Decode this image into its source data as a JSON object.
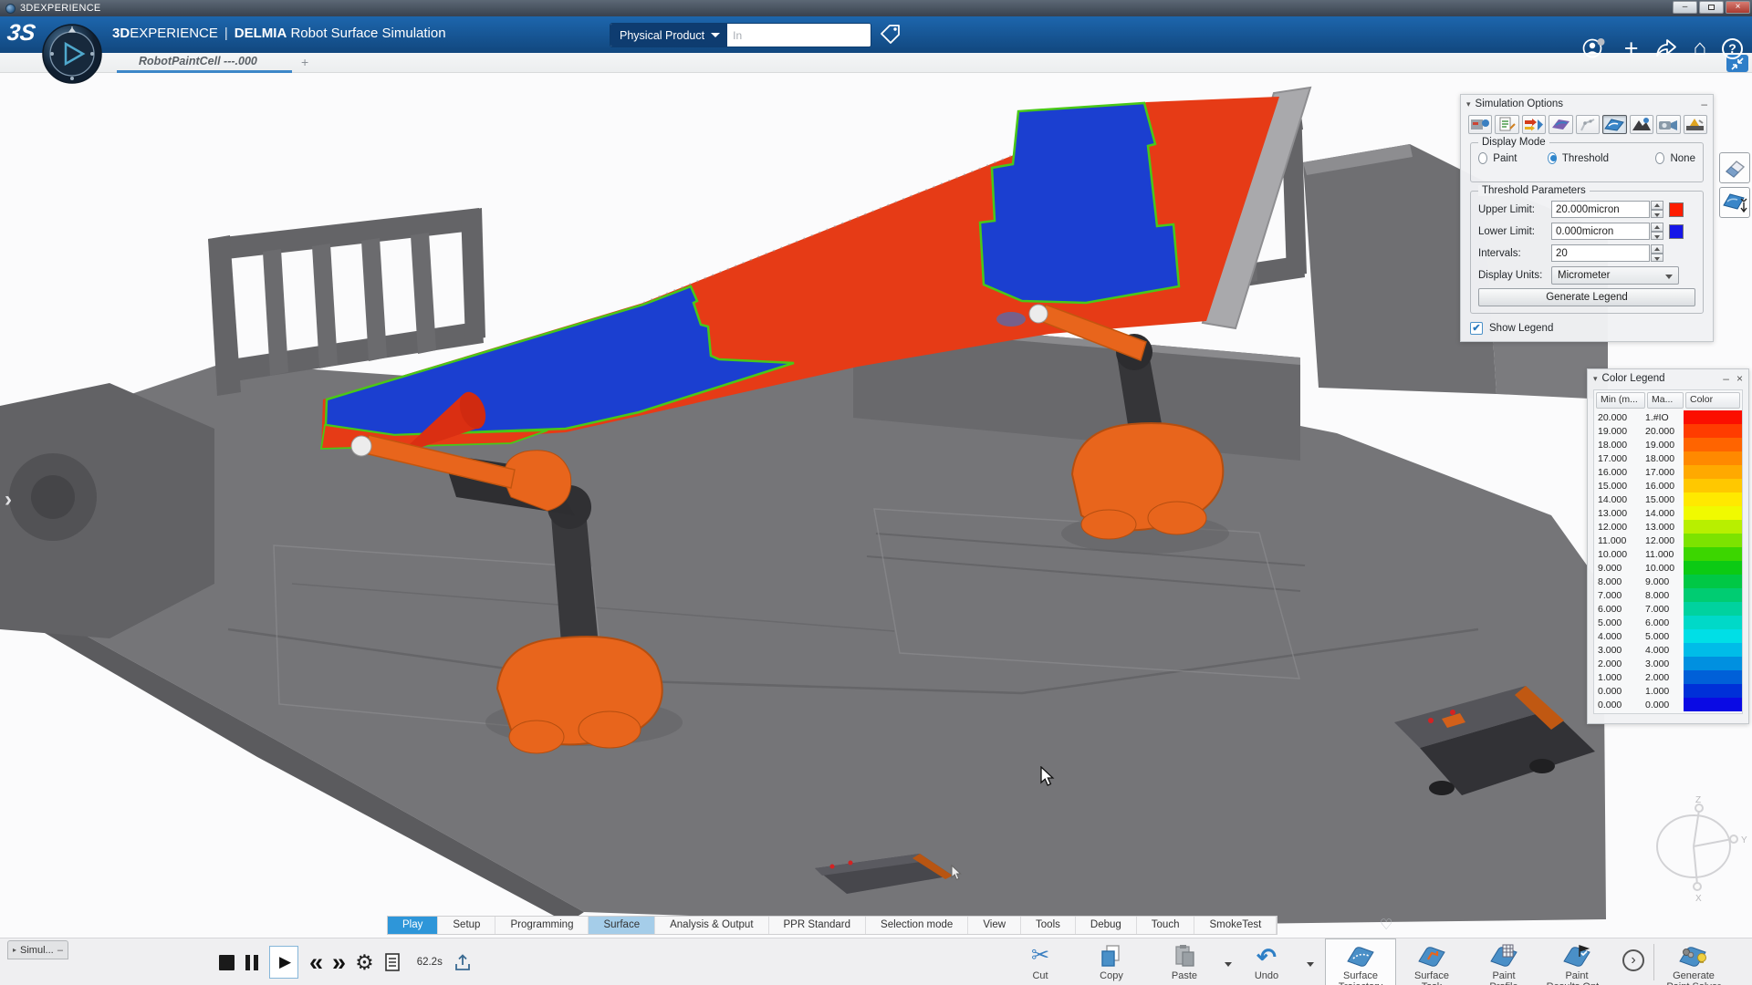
{
  "window": {
    "title": "3DEXPERIENCE"
  },
  "icons": {
    "collapse": "▾",
    "expand": "▸",
    "minimize": "–",
    "close": "×",
    "plus": "+",
    "home": "⌂",
    "help": "?",
    "heart": "♡",
    "stop": "",
    "play": "▶",
    "rewind": "«",
    "forward": "»",
    "gear": "⚙",
    "cut": "✂",
    "undo": "↶",
    "more": "›",
    "edge_chevron": "›"
  },
  "header": {
    "brand_3d": "3D",
    "brand_experience": "EXPERIENCE",
    "divider": "|",
    "app_brand": "DELMIA",
    "app_title": "Robot Surface Simulation",
    "search_scope": "Physical Product",
    "search_placeholder": "In"
  },
  "tabbar": {
    "document_tab": "RobotPaintCell ---.000"
  },
  "sim_options": {
    "title": "Simulation Options",
    "display_mode": {
      "title": "Display Mode",
      "paint": "Paint",
      "threshold": "Threshold",
      "none": "None",
      "selected": "Threshold"
    },
    "threshold_parameters": {
      "title": "Threshold Parameters",
      "upper_limit_label": "Upper Limit:",
      "upper_limit_value": "20.000micron",
      "upper_limit_color": "#fe1d00",
      "lower_limit_label": "Lower Limit:",
      "lower_limit_value": "0.000micron",
      "lower_limit_color": "#1616e8",
      "intervals_label": "Intervals:",
      "intervals_value": "20",
      "display_units_label": "Display Units:",
      "display_units_value": "Micrometer",
      "generate_button": "Generate Legend"
    },
    "show_legend": {
      "label": "Show Legend",
      "checked": true,
      "check_glyph": "✔"
    }
  },
  "color_legend": {
    "title": "Color Legend",
    "col_min": "Min (m...",
    "col_max": "Ma...",
    "col_color": "Color",
    "rows": [
      {
        "min": "20.000",
        "max": "1.#IO",
        "color": "#fb0f00"
      },
      {
        "min": "19.000",
        "max": "20.000",
        "color": "#ff3c00"
      },
      {
        "min": "18.000",
        "max": "19.000",
        "color": "#ff6400"
      },
      {
        "min": "17.000",
        "max": "18.000",
        "color": "#ff8900"
      },
      {
        "min": "16.000",
        "max": "17.000",
        "color": "#ffa900"
      },
      {
        "min": "15.000",
        "max": "16.000",
        "color": "#ffc800"
      },
      {
        "min": "14.000",
        "max": "15.000",
        "color": "#ffe900"
      },
      {
        "min": "13.000",
        "max": "14.000",
        "color": "#f0fa00"
      },
      {
        "min": "12.000",
        "max": "13.000",
        "color": "#b8ef00"
      },
      {
        "min": "11.000",
        "max": "12.000",
        "color": "#7ce300"
      },
      {
        "min": "10.000",
        "max": "11.000",
        "color": "#3cd600"
      },
      {
        "min": "9.000",
        "max": "10.000",
        "color": "#0cca14"
      },
      {
        "min": "8.000",
        "max": "9.000",
        "color": "#00c845"
      },
      {
        "min": "7.000",
        "max": "8.000",
        "color": "#00cc72"
      },
      {
        "min": "6.000",
        "max": "7.000",
        "color": "#00d29f"
      },
      {
        "min": "5.000",
        "max": "6.000",
        "color": "#00d9c8"
      },
      {
        "min": "4.000",
        "max": "5.000",
        "color": "#00dfe6"
      },
      {
        "min": "3.000",
        "max": "4.000",
        "color": "#00bce8"
      },
      {
        "min": "2.000",
        "max": "3.000",
        "color": "#0090e0"
      },
      {
        "min": "1.000",
        "max": "2.000",
        "color": "#0060d8"
      },
      {
        "min": "0.000",
        "max": "1.000",
        "color": "#0030d8"
      },
      {
        "min": "0.000",
        "max": "0.000",
        "color": "#0a0ae4"
      }
    ]
  },
  "bottom_tabs": {
    "tabs": [
      {
        "label": "Play",
        "state": "active"
      },
      {
        "label": "Setup",
        "state": "normal"
      },
      {
        "label": "Programming",
        "state": "normal"
      },
      {
        "label": "Surface",
        "state": "highlight"
      },
      {
        "label": "Analysis & Output",
        "state": "normal"
      },
      {
        "label": "PPR Standard",
        "state": "normal"
      },
      {
        "label": "Selection mode",
        "state": "normal"
      },
      {
        "label": "View",
        "state": "normal"
      },
      {
        "label": "Tools",
        "state": "normal"
      },
      {
        "label": "Debug",
        "state": "normal"
      },
      {
        "label": "Touch",
        "state": "normal"
      },
      {
        "label": "SmokeTest",
        "state": "normal"
      }
    ]
  },
  "player": {
    "collapsed_panel": "Simul...",
    "time": "62.2s"
  },
  "actions": {
    "cut": "Cut",
    "copy": "Copy",
    "paste": "Paste",
    "undo": "Undo",
    "surface_trajectory_1": "Surface",
    "surface_trajectory_2": "Trajectory",
    "surface_task_1": "Surface",
    "surface_task_2": "Task",
    "paint_profile_1": "Paint",
    "paint_profile_2": "Profile",
    "paint_results_1": "Paint",
    "paint_results_2": "Results Opt...",
    "generate_1": "Generate",
    "generate_2": "Paint Solver"
  },
  "scene": {
    "colors": {
      "floor": "#757578",
      "robot_orange": "#e8651c",
      "surface_red": "#e63b16",
      "surface_blue": "#1b3fd0",
      "boundary_green": "#49c818"
    },
    "compass": {
      "x": "X",
      "y": "Y",
      "z": "Z"
    }
  }
}
